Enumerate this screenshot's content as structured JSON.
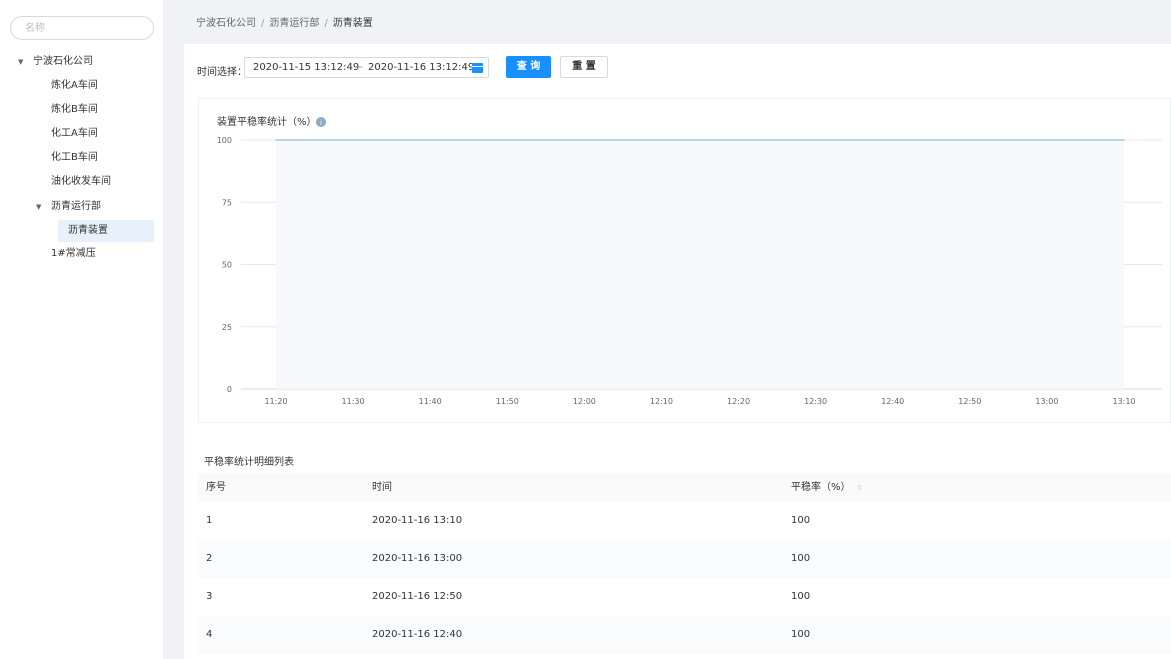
{
  "sidebar": {
    "search_placeholder": "名称",
    "tree": [
      {
        "label": "宁波石化公司",
        "expanded": true
      },
      {
        "label": "炼化A车间"
      },
      {
        "label": "炼化B车间"
      },
      {
        "label": "化工A车间"
      },
      {
        "label": "化工B车间"
      },
      {
        "label": "油化收发车间"
      },
      {
        "label": "沥青运行部",
        "expanded": true
      },
      {
        "label": "沥青装置",
        "selected": true
      },
      {
        "label": "1#常减压"
      }
    ]
  },
  "breadcrumb": [
    "宁波石化公司",
    "沥青运行部",
    "沥青装置"
  ],
  "breadcrumb_separator": "/",
  "filter": {
    "label": "时间选择：",
    "start": "2020-11-15 13:12:49",
    "separator": "~",
    "end": "2020-11-16 13:12:49",
    "query_button": "查 询",
    "reset_button": "重 置"
  },
  "chart_data": {
    "type": "area",
    "title": "装置平稳率统计（%）",
    "x": [
      "11:20",
      "11:30",
      "11:40",
      "11:50",
      "12:00",
      "12:10",
      "12:20",
      "12:30",
      "12:40",
      "12:50",
      "13:00",
      "13:10"
    ],
    "y_ticks": [
      0,
      25,
      50,
      75,
      100
    ],
    "ylim": [
      0,
      100
    ],
    "series": [
      {
        "values": [
          100,
          100,
          100,
          100,
          100,
          100,
          100,
          100,
          100,
          100,
          100,
          100
        ]
      }
    ],
    "grid": true,
    "colors": {
      "line": "#9cc9e3",
      "area": "#f7f9fc"
    }
  },
  "table": {
    "title": "平稳率统计明细列表",
    "columns": [
      "序号",
      "时间",
      "平稳率（%）"
    ],
    "rows": [
      [
        "1",
        "2020-11-16 13:10",
        "100"
      ],
      [
        "2",
        "2020-11-16 13:00",
        "100"
      ],
      [
        "3",
        "2020-11-16 12:50",
        "100"
      ],
      [
        "4",
        "2020-11-16 12:40",
        "100"
      ]
    ]
  },
  "colors": {
    "accent": "#1890ff",
    "selected_bg": "#e6f1fc"
  }
}
